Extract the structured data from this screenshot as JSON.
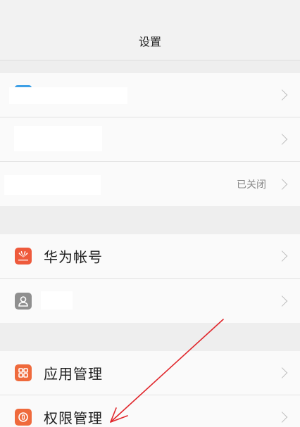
{
  "header": {
    "title": "设置"
  },
  "rows": {
    "row1": {
      "label": "",
      "value": ""
    },
    "row2": {
      "label": "",
      "value": ""
    },
    "row3": {
      "label": "",
      "value": "已关闭"
    },
    "huawei": {
      "label": "华为帐号"
    },
    "contacts": {
      "label": ""
    },
    "app_mgmt": {
      "label": "应用管理"
    },
    "perm_mgmt": {
      "label": "权限管理"
    }
  },
  "colors": {
    "huawei_icon": "#ee5a3c",
    "contact_icon": "#8f8f8f",
    "app_icon": "#ef6a3c",
    "perm_icon": "#ef6a3c",
    "annotation_arrow": "#e0262b"
  },
  "icons": {
    "huawei": "huawei-logo-icon",
    "contacts": "person-icon",
    "app_mgmt": "grid-icon",
    "perm_mgmt": "shield-icon"
  }
}
